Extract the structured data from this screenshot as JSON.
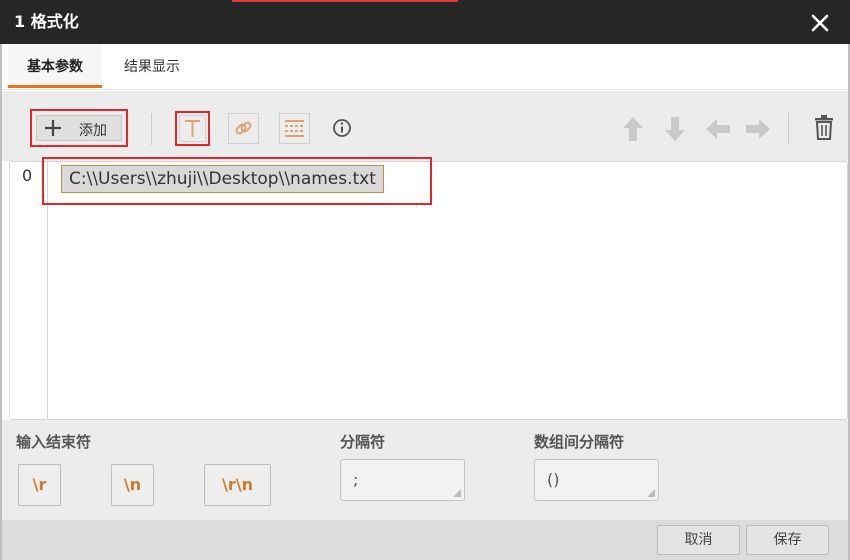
{
  "window": {
    "title": "1 格式化",
    "close_icon": "close-icon"
  },
  "tabs": [
    {
      "label": "基本参数",
      "active": true
    },
    {
      "label": "结果显示",
      "active": false
    }
  ],
  "toolbar": {
    "add_label": "添加",
    "add_icon": "plus-icon",
    "icons": [
      "text-icon",
      "link-icon",
      "separator-format-icon",
      "info-icon",
      "arrow-up-icon",
      "arrow-down-icon",
      "arrow-left-icon",
      "arrow-right-icon",
      "trash-icon"
    ]
  },
  "editor": {
    "lines": [
      {
        "number": "0",
        "value": "C:\\\\Users\\\\zhuji\\\\Desktop\\\\names.txt"
      }
    ]
  },
  "settings": {
    "terminator": {
      "label": "输入结束符",
      "options": [
        "\\r",
        "\\n",
        "\\r\\n"
      ]
    },
    "separator": {
      "label": "分隔符",
      "value": ";"
    },
    "array_separator": {
      "label": "数组间分隔符",
      "value": "()"
    }
  },
  "footer": {
    "cancel_label": "取消",
    "save_label": "保存"
  },
  "colors": {
    "accent": "#e8711c",
    "highlight_border": "#e2262a",
    "titlebar": "#262626"
  }
}
